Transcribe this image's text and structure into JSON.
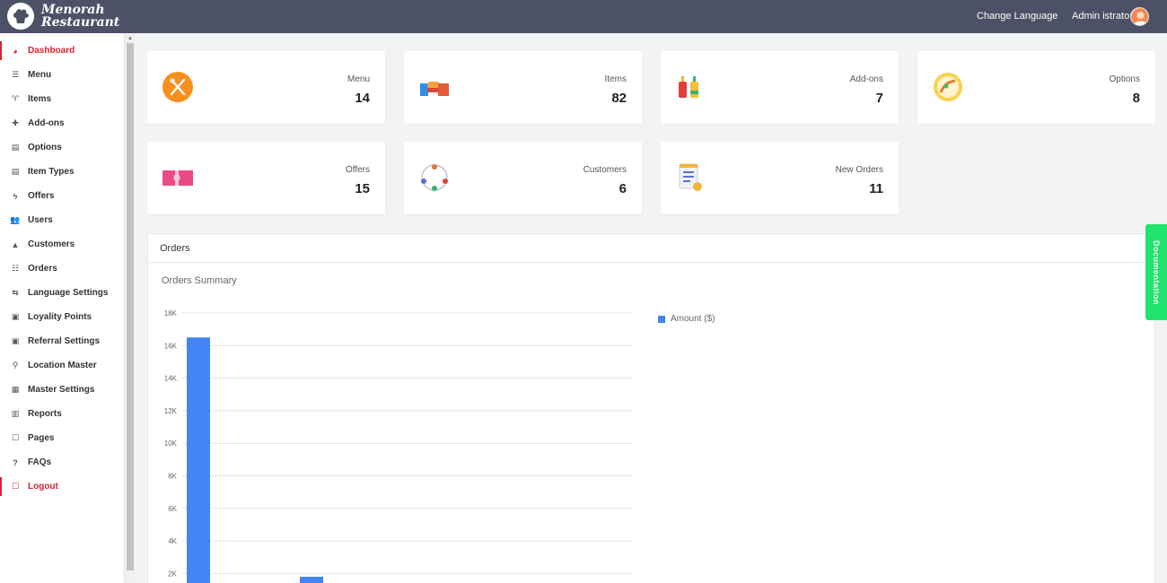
{
  "header": {
    "logo_line1": "Menorah",
    "logo_line2": "Restaurant",
    "change_language": "Change Language",
    "user_name": "Admin istrator"
  },
  "sidebar": {
    "items": [
      {
        "label": "Dashboard",
        "icon": "dashboard-icon",
        "active": true
      },
      {
        "label": "Menu",
        "icon": "menu-bars-icon"
      },
      {
        "label": "Items",
        "icon": "cutlery-icon"
      },
      {
        "label": "Add-ons",
        "icon": "plus-icon"
      },
      {
        "label": "Options",
        "icon": "list-icon"
      },
      {
        "label": "Item Types",
        "icon": "list-icon"
      },
      {
        "label": "Offers",
        "icon": "bolt-icon"
      },
      {
        "label": "Users",
        "icon": "users-icon"
      },
      {
        "label": "Customers",
        "icon": "user-icon"
      },
      {
        "label": "Orders",
        "icon": "list-lines-icon"
      },
      {
        "label": "Language Settings",
        "icon": "translate-icon"
      },
      {
        "label": "Loyality Points",
        "icon": "gift-icon"
      },
      {
        "label": "Referral Settings",
        "icon": "gift-icon"
      },
      {
        "label": "Location Master",
        "icon": "map-marker-icon"
      },
      {
        "label": "Master Settings",
        "icon": "grid-icon"
      },
      {
        "label": "Reports",
        "icon": "bar-chart-icon"
      },
      {
        "label": "Pages",
        "icon": "square-icon"
      },
      {
        "label": "FAQs",
        "icon": "question-icon"
      },
      {
        "label": "Logout",
        "icon": "logout-icon",
        "logout": true
      }
    ]
  },
  "cards": [
    {
      "label": "Menu",
      "value": "14",
      "icon": "cutlery-circle-icon"
    },
    {
      "label": "Items",
      "value": "82",
      "icon": "food-items-icon"
    },
    {
      "label": "Add-ons",
      "value": "7",
      "icon": "sauce-bottles-icon"
    },
    {
      "label": "Options",
      "value": "8",
      "icon": "options-circle-icon"
    },
    {
      "label": "Offers",
      "value": "15",
      "icon": "gift-ticket-icon"
    },
    {
      "label": "Customers",
      "value": "6",
      "icon": "customers-network-icon"
    },
    {
      "label": "New Orders",
      "value": "11",
      "icon": "order-list-icon"
    }
  ],
  "orders_panel": {
    "title": "Orders",
    "subtitle": "Orders Summary"
  },
  "documentation_tab": "Documentation",
  "colors": {
    "header_bg": "#4d5165",
    "active_red": "#d9232d",
    "bar_blue": "#4285f4",
    "doc_green": "#1ee36d"
  },
  "chart_data": {
    "type": "bar",
    "categories": [
      "",
      ""
    ],
    "series": [
      {
        "name": "Amount ($)",
        "values": [
          16500,
          1800
        ]
      }
    ],
    "yticks": [
      "18K",
      "16K",
      "14K",
      "12K",
      "10K",
      "8K",
      "6K",
      "4K",
      "2K"
    ],
    "ylim": [
      0,
      18000
    ],
    "legend_position": "right",
    "grid": true
  }
}
